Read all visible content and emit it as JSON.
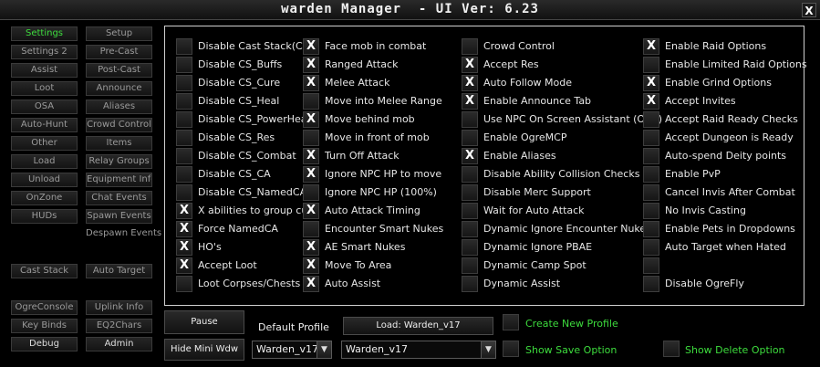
{
  "window": {
    "title": "warden Manager  - UI Ver: 6.23",
    "close_glyph": "X"
  },
  "nav": {
    "settings": "Settings",
    "setup": "Setup",
    "settings2": "Settings 2",
    "precast": "Pre-Cast",
    "assist": "Assist",
    "postcast": "Post-Cast",
    "loot": "Loot",
    "announce": "Announce",
    "osa": "OSA",
    "aliases": "Aliases",
    "autohunt": "Auto-Hunt",
    "crowdcontrol": "Crowd Control",
    "other": "Other",
    "items": "Items",
    "load": "Load",
    "relaygroups": "Relay Groups",
    "unload": "Unload",
    "equipmentinfo": "Equipment Info",
    "onzone": "OnZone",
    "chatevents": "Chat Events",
    "huds": "HUDs",
    "spawnevents": "Spawn Events",
    "despawnevents": "Despawn Events",
    "caststack": "Cast Stack",
    "autotarget": "Auto Target",
    "ogreconsole": "OgreConsole",
    "uplinkinfo": "Uplink Info",
    "keybinds": "Key Binds",
    "eq2chars": "EQ2Chars",
    "debug": "Debug",
    "admin": "Admin"
  },
  "options": {
    "col1": [
      {
        "label": "Disable Cast Stack(CS)",
        "checked": false
      },
      {
        "label": "Disable CS_Buffs",
        "checked": false
      },
      {
        "label": "Disable CS_Cure",
        "checked": false
      },
      {
        "label": "Disable CS_Heal",
        "checked": false
      },
      {
        "label": "Disable CS_PowerHeal",
        "checked": false
      },
      {
        "label": "Disable CS_Res",
        "checked": false
      },
      {
        "label": "Disable CS_Combat",
        "checked": false
      },
      {
        "label": "Disable CS_CA",
        "checked": false
      },
      {
        "label": "Disable CS_NamedCA",
        "checked": false
      },
      {
        "label": "X abilities to group cure",
        "checked": true
      },
      {
        "label": "Force NamedCA",
        "checked": true
      },
      {
        "label": "HO's",
        "checked": true
      },
      {
        "label": "Accept Loot",
        "checked": true
      },
      {
        "label": "Loot Corpses/Chests",
        "checked": false
      }
    ],
    "col2": [
      {
        "label": "Face mob in combat",
        "checked": true
      },
      {
        "label": "Ranged Attack",
        "checked": true
      },
      {
        "label": "Melee Attack",
        "checked": true
      },
      {
        "label": "Move into Melee Range",
        "checked": false
      },
      {
        "label": "Move behind mob",
        "checked": true
      },
      {
        "label": "Move in front of mob",
        "checked": false
      },
      {
        "label": "Turn Off Attack",
        "checked": true
      },
      {
        "label": "Ignore NPC HP to move",
        "checked": true
      },
      {
        "label": "Ignore NPC HP (100%)",
        "checked": false
      },
      {
        "label": "Auto Attack Timing",
        "checked": true
      },
      {
        "label": "Encounter Smart Nukes",
        "checked": false
      },
      {
        "label": "AE Smart Nukes",
        "checked": true
      },
      {
        "label": "Move To Area",
        "checked": true
      },
      {
        "label": "Auto Assist",
        "checked": true
      }
    ],
    "col3": [
      {
        "label": "Crowd Control",
        "checked": false
      },
      {
        "label": "Accept Res",
        "checked": true
      },
      {
        "label": "Auto Follow Mode",
        "checked": true
      },
      {
        "label": "Enable Announce Tab",
        "checked": true
      },
      {
        "label": "Use NPC On Screen Assistant (OSA)",
        "checked": false
      },
      {
        "label": "Enable OgreMCP",
        "checked": false
      },
      {
        "label": "Enable Aliases",
        "checked": true
      },
      {
        "label": "Disable Ability Collision Checks",
        "checked": false
      },
      {
        "label": "Disable Merc Support",
        "checked": false
      },
      {
        "label": "Wait for Auto Attack",
        "checked": false
      },
      {
        "label": "Dynamic Ignore Encounter Nukes",
        "checked": false
      },
      {
        "label": "Dynamic Ignore PBAE",
        "checked": false
      },
      {
        "label": "Dynamic Camp Spot",
        "checked": false
      },
      {
        "label": "Dynamic Assist",
        "checked": false
      }
    ],
    "col4": [
      {
        "label": "Enable Raid Options",
        "checked": true
      },
      {
        "label": "Enable Limited Raid Options",
        "checked": false
      },
      {
        "label": "Enable Grind Options",
        "checked": true
      },
      {
        "label": "Accept Invites",
        "checked": true
      },
      {
        "label": "Accept Raid Ready Checks",
        "checked": false
      },
      {
        "label": "Accept Dungeon is Ready",
        "checked": false
      },
      {
        "label": "Auto-spend Deity points",
        "checked": false
      },
      {
        "label": "Enable PvP",
        "checked": false
      },
      {
        "label": "Cancel Invis After Combat",
        "checked": false
      },
      {
        "label": "No Invis Casting",
        "checked": false
      },
      {
        "label": "Enable Pets in Dropdowns",
        "checked": false
      },
      {
        "label": "Auto Target when Hated",
        "checked": false
      },
      {
        "label": "",
        "checked": false
      },
      {
        "label": "Disable OgreFly",
        "checked": false
      }
    ]
  },
  "bottom": {
    "pause": "Pause",
    "hide_mini": "Hide Mini Wdw",
    "default_profile_label": "Default Profile",
    "default_profile_value": "Warden_v17",
    "load_button": "Load: Warden_v17",
    "load_select_value": "Warden_v17",
    "create_profile": "Create New Profile",
    "show_save": "Show Save Option",
    "show_delete": "Show Delete Option",
    "dropdown_glyph": "▼"
  },
  "colors": {
    "accent_green": "#3ddc3d",
    "panel_border": "#cfcfcf"
  }
}
